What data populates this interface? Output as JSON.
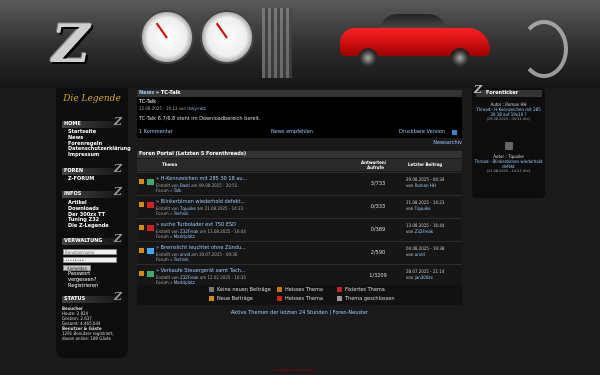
{
  "left": {
    "legend": "Die Legende",
    "home_header": "HOME",
    "home_items": [
      "Startseite",
      "News",
      "Forenregeln",
      "Datenschutzerklärung",
      "Impressum"
    ],
    "foren_header": "FOREN",
    "foren_items": [
      "Z-FORUM"
    ],
    "infos_header": "INFOS",
    "infos_items": [
      "Artikel",
      "Downloads",
      "Der 300zx TT",
      "Tuning Z32",
      "Die Z-Legende"
    ],
    "login_header": "VERWALTUNG",
    "username_placeholder": "Benutzername",
    "password_value": "••••••••",
    "login_button": "Anmelden",
    "forgot": [
      "Passwort",
      "vergessen?",
      "Registrieren"
    ],
    "status_header": "STATUS",
    "status_lines": [
      "Besucher",
      "Heute:   2.824",
      "Gestern: 2.637",
      "Gesamt: 4.465.044",
      "Benutzer & Gäste",
      "1291 Benutzer registriert,",
      "davon online: 189 Gäste"
    ]
  },
  "main": {
    "crumb_a": "News",
    "crumb_b": "» TC-Talk",
    "news_title": "TC-Talk",
    "news_date": "22.08.2025 - 14:13 von",
    "news_author": "ricky-rotz",
    "news_body": "TC-Talk 6.7/6.8 steht im Downloadbereich bereit.",
    "comment_link": "1 Kommentar",
    "recommend_link": "News empfehlen",
    "print_link": "Druckbare Version",
    "archive_link": "Newsarchiv",
    "forum_header": "Foren Portal (Letzten 5 Forenthreads)",
    "col_thema": "Thema",
    "col_answers": "Antworten/",
    "col_answers2": "Aufrufe",
    "col_last": "Letzter Beitrag",
    "rows": [
      {
        "title": "» H-Kennzeichen mit 285 30 18 au...",
        "created": "Erstellt von",
        "by": "Basti",
        "date": "am 09.08.2025 - 20:55",
        "forum": "Forum »",
        "forum_name": "Talk",
        "count": "3/733",
        "last_date": "29.08.2025 - 04:34",
        "last_by": "Roman HH",
        "icon": "#4a6"
      },
      {
        "title": "» Blinkerbirnen wiederhold defekt...",
        "created": "Erstellt von",
        "by": "Tquuike",
        "date": "am 21.08.2025 - 14:23",
        "forum": "Forum »",
        "forum_name": "Technik",
        "count": "0/333",
        "last_date": "21.08.2025 - 14:23",
        "last_by": "Tquuike",
        "icon": "#c22"
      },
      {
        "title": "» suche Turbolader evt 750 ESD",
        "created": "Erstellt von",
        "by": "Z32Freak",
        "date": "am 13.08.2025 - 16:44",
        "forum": "Forum »",
        "forum_name": "Marktplatz",
        "count": "0/389",
        "last_date": "13.08.2025 - 16:44",
        "last_by": "Z32Freak",
        "icon": "#c22"
      },
      {
        "title": "» Bremslicht leuchtet ohne Zündu...",
        "created": "Erstellt von",
        "by": "arvid",
        "date": "am 30.07.2025 - 09:36",
        "forum": "Forum »",
        "forum_name": "Technik",
        "count": "2/590",
        "last_date": "04.08.2025 - 19:38",
        "last_by": "arvid",
        "icon": "#4af"
      },
      {
        "title": "» Verkaufe Steuergerät samt Tach...",
        "created": "Erstellt von",
        "by": "Z32Freak",
        "date": "am 12.02.2025 - 16:35",
        "forum": "Forum »",
        "forum_name": "Marktplatz",
        "count": "1/3209",
        "last_date": "28.07.2025 - 21:14",
        "last_by": "jan300zx",
        "icon": "#4a6"
      }
    ],
    "key": [
      "Keine neuen Beiträge",
      "Heisses Thema",
      "Fixiertes Thema",
      "Neue Beiträge",
      "Heisses Thema",
      "Thema geschlossen"
    ],
    "footer_a": "Aktive Themen der letzten 24 Stunden",
    "footer_sep": " | ",
    "footer_b": "Foren-Neuster"
  },
  "ticker": {
    "header": "Forenticker",
    "e1_author": "Autor : Roman HH",
    "e1_title": "Thread - H-Kennzeichen mit 285 30 18 auf 19x10 ?",
    "e1_date": "(29.08.2025 - 04:34 Uhr)",
    "e2_author": "Autor : Tquuike",
    "e2_title": "Thread - Blinkerbirnen wiederhold defekt",
    "e2_date": "(21.08.2025 - 14:23 Uhr)"
  },
  "footer_text": "POWERED BY PHP-FUSION"
}
